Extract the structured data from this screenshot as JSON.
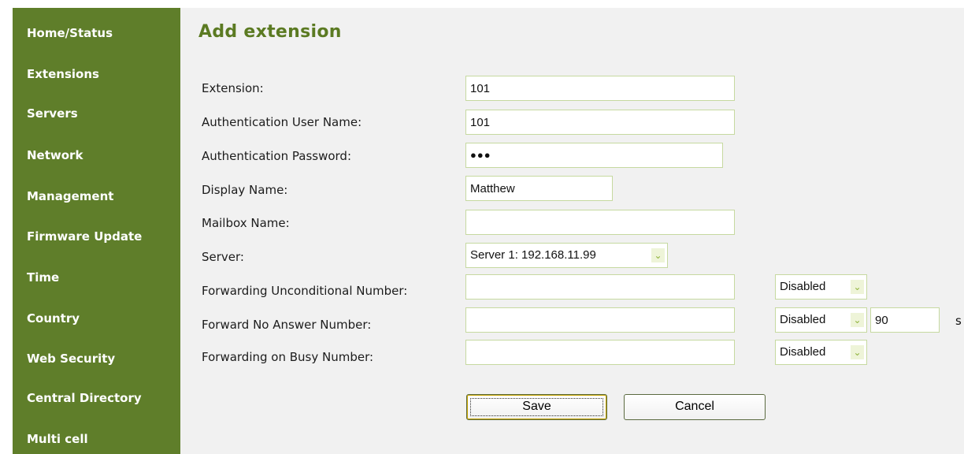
{
  "sidebar": {
    "items": [
      {
        "label": "Home/Status"
      },
      {
        "label": "Extensions"
      },
      {
        "label": "Servers"
      },
      {
        "label": "Network"
      },
      {
        "label": "Management"
      },
      {
        "label": "Firmware Update"
      },
      {
        "label": "Time"
      },
      {
        "label": "Country"
      },
      {
        "label": "Web Security"
      },
      {
        "label": "Central Directory"
      },
      {
        "label": "Multi cell"
      }
    ]
  },
  "page": {
    "title": "Add extension"
  },
  "form": {
    "extension": {
      "label": "Extension:",
      "value": "101"
    },
    "auth_user": {
      "label": "Authentication User Name:",
      "value": "101"
    },
    "auth_password": {
      "label": "Authentication Password:",
      "value": "●●●"
    },
    "display_name": {
      "label": "Display Name:",
      "value": "Matthew"
    },
    "mailbox_name": {
      "label": "Mailbox Name:",
      "value": ""
    },
    "server": {
      "label": "Server:",
      "value": "Server 1: 192.168.11.99"
    },
    "fwd_unconditional": {
      "label": "Forwarding Unconditional Number:",
      "value": "",
      "mode": "Disabled"
    },
    "fwd_no_answer": {
      "label": "Forward No Answer Number:",
      "value": "",
      "mode": "Disabled",
      "timeout": "90",
      "unit": "s"
    },
    "fwd_busy": {
      "label": "Forwarding on Busy Number:",
      "value": "",
      "mode": "Disabled"
    }
  },
  "buttons": {
    "save": "Save",
    "cancel": "Cancel"
  },
  "icons": {
    "dropdown": "chevron-down-icon"
  },
  "colors": {
    "sidebar_bg": "#5f7e2a",
    "title": "#5b7a22",
    "field_border": "#c6d9a0",
    "content_bg": "#f1f1f1"
  }
}
